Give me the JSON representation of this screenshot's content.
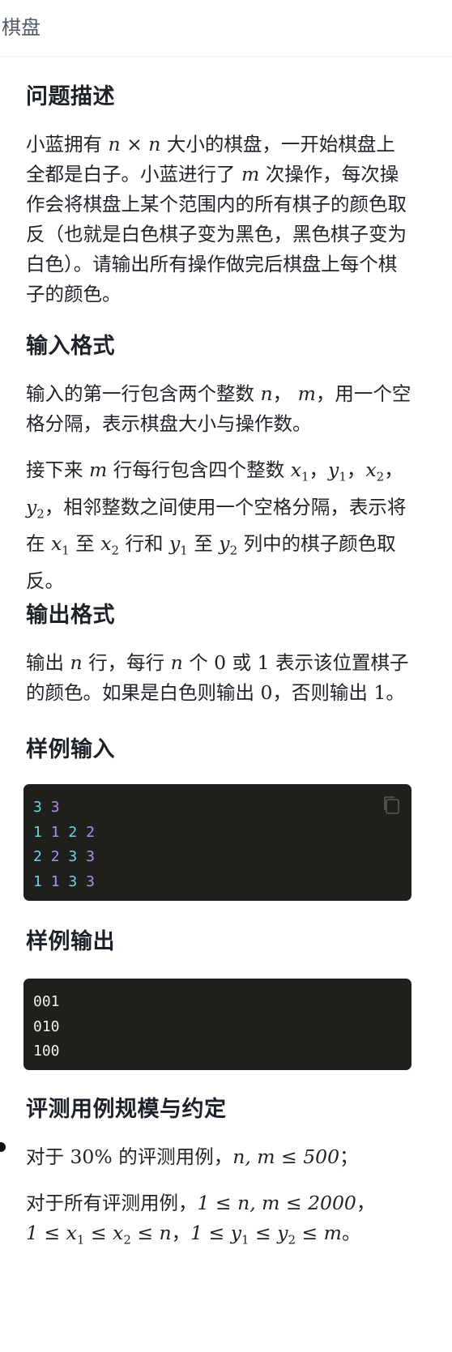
{
  "page": {
    "title": "棋盘"
  },
  "desc": {
    "heading": "问题描述",
    "p1_a": "小蓝拥有 ",
    "p1_n1": "n",
    "p1_times": " × ",
    "p1_n2": "n",
    "p1_b": " 大小的棋盘，一开始棋盘上",
    "p2": "全都是白子。小蓝进行了 ",
    "p2_m": "m",
    "p2_b": " 次操作，每次操",
    "p3": "作会将棋盘上某个范围内的所有棋子的颜色取",
    "p4": "反（也就是白色棋子变为黑色，黑色棋子变为",
    "p5": "白色）。请输出所有操作做完后棋盘上每个棋",
    "p6": "子的颜色。"
  },
  "input": {
    "heading": "输入格式",
    "l1_a": "输入的第一行包含两个整数 ",
    "l1_n": "n",
    "l1_sep": "， ",
    "l1_m": "m",
    "l1_b": "，用一个空",
    "l2": "格分隔，表示棋盘大小与操作数。",
    "l3_a": "接下来 ",
    "l3_m": "m",
    "l3_b": " 行每行包含四个整数 ",
    "x1": "x",
    "y1": "y",
    "x2": "x",
    "y2": "y",
    "sub1": "1",
    "sub2": "2",
    "comma": "，",
    "l4_b": "，相邻整数之间使用一个空格分隔，表示将",
    "l5_a": "在 ",
    "l5_to": " 至 ",
    "l5_mid": " 行和 ",
    "l5_b": " 列中的棋子颜色取",
    "l6": "反。"
  },
  "output": {
    "heading": "输出格式",
    "l1_a": "输出 ",
    "n": "n",
    "l1_b": " 行，每行 ",
    "l1_c": " 个 ",
    "zero": "0",
    "l1_d": " 或 ",
    "one": "1",
    "l1_e": " 表示该位置棋子",
    "l2_a": "的颜色。如果是白色则输出 ",
    "l2_b": "，否则输出 ",
    "l2_c": "。"
  },
  "sample_input": {
    "heading": "样例输入",
    "lines": [
      [
        "3",
        "3"
      ],
      [
        "1",
        "1",
        "2",
        "2"
      ],
      [
        "2",
        "2",
        "3",
        "3"
      ],
      [
        "1",
        "1",
        "3",
        "3"
      ]
    ]
  },
  "sample_output": {
    "heading": "样例输出",
    "lines": [
      "001",
      "010",
      "100"
    ]
  },
  "scale": {
    "heading": "评测用例规模与约定",
    "l1_a": "对于 ",
    "l1_pct": "30%",
    "l1_b": " 的评测用例，",
    "l1_math": "n, m ≤ 500",
    "l1_c": "；",
    "l2_a": "对于所有评测用例，",
    "l2_math": "1 ≤ n, m ≤ 2000",
    "l2_b": "，",
    "l3_math_a": "1 ≤ ",
    "l3_le": " ≤ ",
    "l3_le2": " ≤ ",
    "l3_n": "n",
    "l3_sep": "，",
    "l3_m": "m",
    "l3_end": "。"
  },
  "colors": {
    "code_bg": "#1f1f1c",
    "tok_a": "#6bd4e8",
    "tok_b": "#b18cf0"
  },
  "icons": {
    "copy": "copy-icon"
  }
}
